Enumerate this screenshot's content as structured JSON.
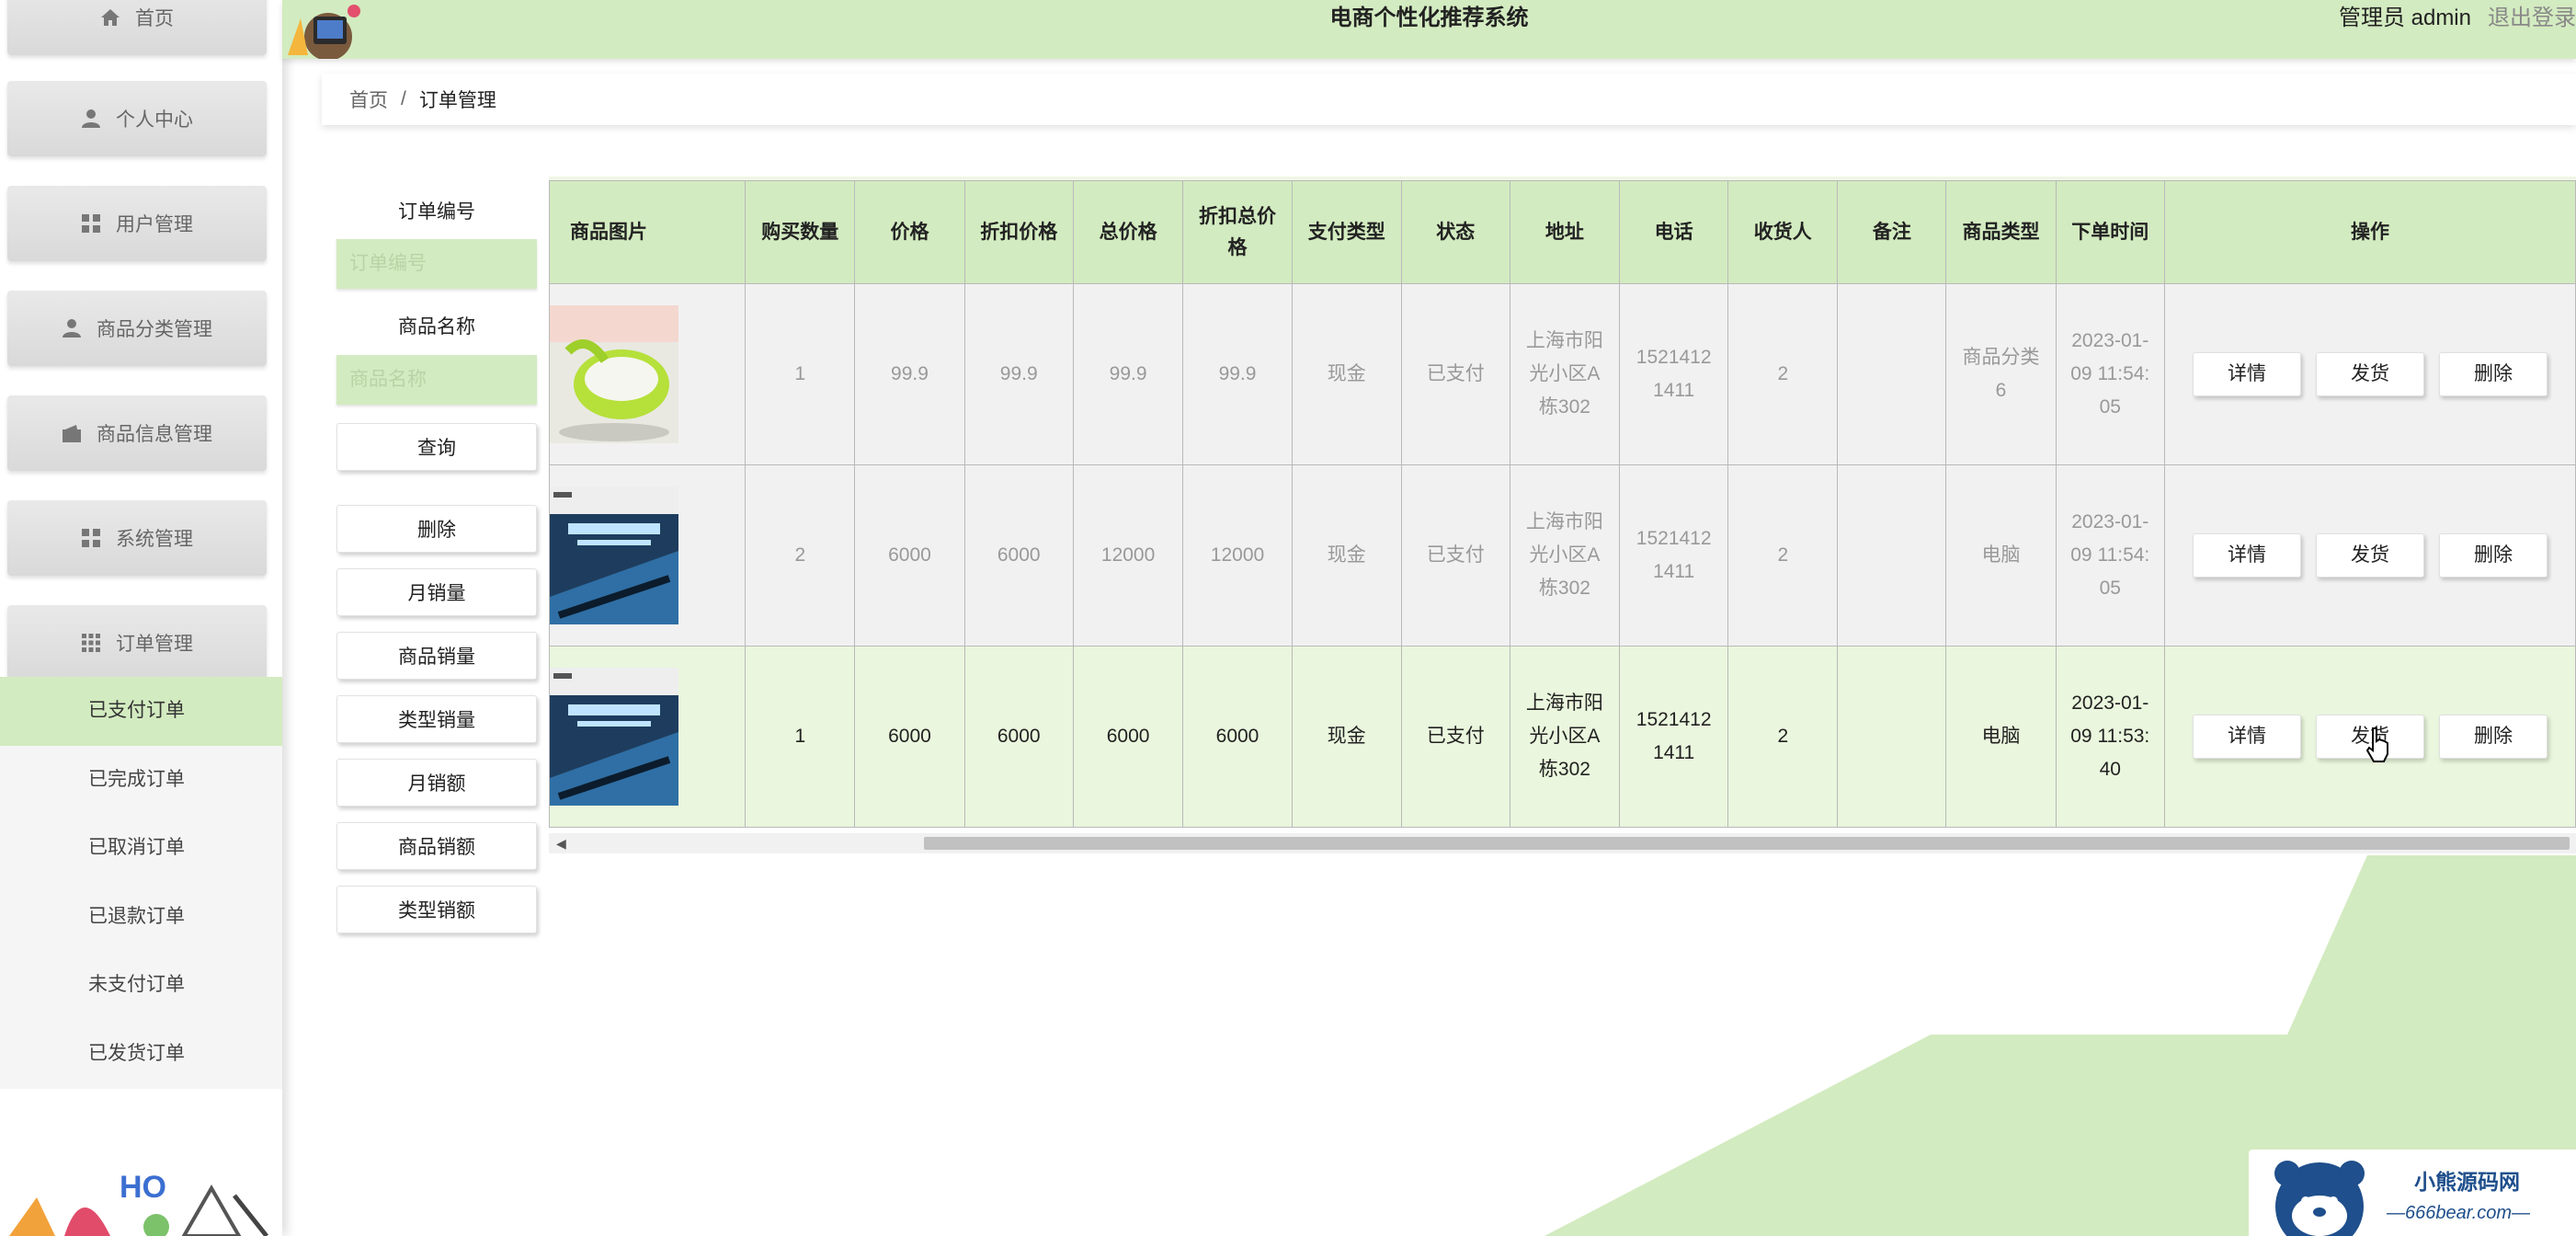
{
  "app": {
    "title": "电商个性化推荐系统"
  },
  "header": {
    "user": "管理员 admin",
    "logout": "退出登录"
  },
  "sidebar": {
    "menu": [
      {
        "label": "首页",
        "icon": "home-icon"
      },
      {
        "label": "个人中心",
        "icon": "user-icon"
      },
      {
        "label": "用户管理",
        "icon": "grid-icon"
      },
      {
        "label": "商品分类管理",
        "icon": "user-icon"
      },
      {
        "label": "商品信息管理",
        "icon": "wallet-icon"
      },
      {
        "label": "系统管理",
        "icon": "grid-icon"
      },
      {
        "label": "订单管理",
        "icon": "apps-icon"
      }
    ],
    "submenu": [
      {
        "label": "已支付订单",
        "active": true
      },
      {
        "label": "已完成订单"
      },
      {
        "label": "已取消订单"
      },
      {
        "label": "已退款订单"
      },
      {
        "label": "未支付订单"
      },
      {
        "label": "已发货订单"
      }
    ]
  },
  "breadcrumb": {
    "home": "首页",
    "separator": "/",
    "current": "订单管理"
  },
  "search": {
    "order_no_label": "订单编号",
    "order_no_placeholder": "订单编号",
    "product_name_label": "商品名称",
    "product_name_placeholder": "商品名称",
    "query": "查询",
    "delete": "删除",
    "monthly_sales": "月销量",
    "product_sales": "商品销量",
    "type_sales": "类型销量",
    "monthly_amount": "月销额",
    "product_amount": "商品销额",
    "type_amount": "类型销额"
  },
  "table": {
    "headers": [
      "商品图片",
      "购买数量",
      "价格",
      "折扣价格",
      "总价格",
      "折扣总价格",
      "支付类型",
      "状态",
      "地址",
      "电话",
      "收货人",
      "备注",
      "商品类型",
      "下单时间",
      "操作"
    ],
    "rows": [
      {
        "image": "bowl",
        "qty": "1",
        "price": "99.9",
        "discount_price": "99.9",
        "total": "99.9",
        "discount_total": "99.9",
        "pay_type": "现金",
        "status": "已支付",
        "address": "上海市阳光小区A栋302",
        "phone": "15214121411",
        "receiver": "2",
        "note": "",
        "category": "商品分类6",
        "time": "2023-01-09 11:54:05"
      },
      {
        "image": "laptop",
        "qty": "2",
        "price": "6000",
        "discount_price": "6000",
        "total": "12000",
        "discount_total": "12000",
        "pay_type": "现金",
        "status": "已支付",
        "address": "上海市阳光小区A栋302",
        "phone": "15214121411",
        "receiver": "2",
        "note": "",
        "category": "电脑",
        "time": "2023-01-09 11:54:05"
      },
      {
        "image": "laptop",
        "qty": "1",
        "price": "6000",
        "discount_price": "6000",
        "total": "6000",
        "discount_total": "6000",
        "pay_type": "现金",
        "status": "已支付",
        "address": "上海市阳光小区A栋302",
        "phone": "15214121411",
        "receiver": "2",
        "note": "",
        "category": "电脑",
        "time": "2023-01-09 11:53:40"
      }
    ],
    "actions": {
      "detail": "详情",
      "ship": "发货",
      "delete": "删除"
    }
  },
  "watermark": {
    "line1": "小熊源码网",
    "line2": "—666bear.com—"
  },
  "colors": {
    "accent": "#d3ebc0",
    "highlight_row": "#eaf6dd"
  }
}
